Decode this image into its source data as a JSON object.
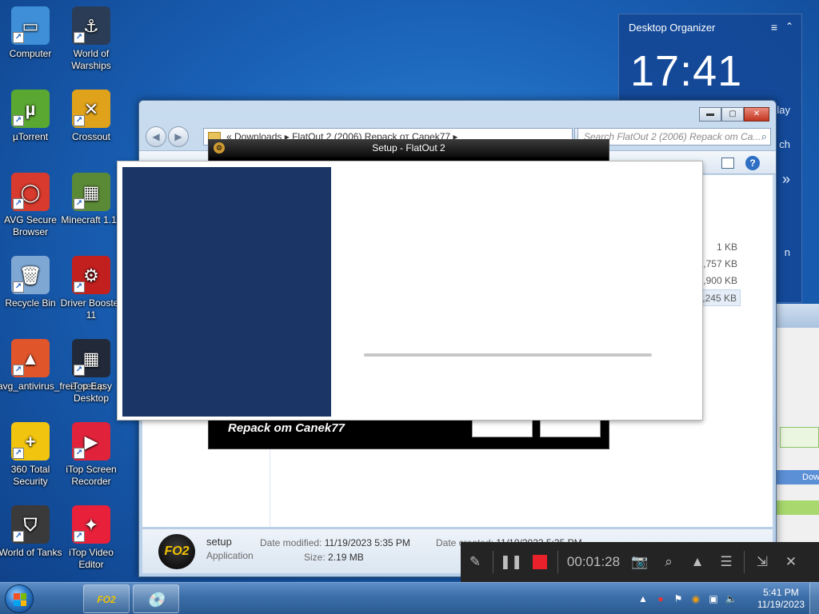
{
  "desktop": {
    "icons": [
      {
        "label": "Computer",
        "glyph": "▭",
        "color": "#3f8fd8"
      },
      {
        "label": "World of Warships",
        "glyph": "⚓",
        "color": "#2b3d56"
      },
      {
        "label": "µTorrent",
        "glyph": "µ",
        "color": "#5aa832"
      },
      {
        "label": "Crossout",
        "glyph": "✕",
        "color": "#e0a21a"
      },
      {
        "label": "AVG Secure Browser",
        "glyph": "◯",
        "color": "#d83a2d"
      },
      {
        "label": "Minecraft 1.11",
        "glyph": "▦",
        "color": "#5b8a37"
      },
      {
        "label": "Recycle Bin",
        "glyph": "🗑",
        "color": "#7fa7d3"
      },
      {
        "label": "Driver Booster 11",
        "glyph": "⚙",
        "color": "#c21f1f"
      },
      {
        "label": "avg_antivirus_free_setup",
        "glyph": "▲",
        "color": "#e0552a"
      },
      {
        "label": "iTop Easy Desktop",
        "glyph": "▦",
        "color": "#222a3a"
      },
      {
        "label": "360 Total Security",
        "glyph": "+",
        "color": "#f1c40f"
      },
      {
        "label": "iTop Screen Recorder",
        "glyph": "▶",
        "color": "#e0233a"
      },
      {
        "label": "World of Tanks",
        "glyph": "⛉",
        "color": "#3a3a3a"
      },
      {
        "label": "iTop Video Editor",
        "glyph": "✦",
        "color": "#e8203a"
      }
    ]
  },
  "gadget": {
    "title": "Desktop Organizer",
    "menu_icon": "hamburger-icon",
    "collapse_icon": "chevron-up-icon",
    "clock": "17:41",
    "fragments": [
      "lay",
      "ch",
      "»",
      "n"
    ]
  },
  "explorer": {
    "address": "«  Downloads  ▸  FlatOut 2 (2006) Repack от Canek77  ▸",
    "search_placeholder": "Search FlatOut 2 (2006) Repack om Ca...",
    "file_sizes": [
      "1 KB",
      "5,757 KB",
      "9,900 KB",
      "2,245 KB"
    ],
    "selected_size_index": 3,
    "details": {
      "name": "setup",
      "type": "Application",
      "modified_label": "Date modified:",
      "modified_value": "11/19/2023 5:35 PM",
      "size_label": "Size:",
      "size_value": "2.19 MB",
      "created_label": "Date created:",
      "created_value": "11/19/2023 5:35 PM",
      "icon_text": "FO2"
    }
  },
  "back_window": {
    "partial_label": "Dow"
  },
  "setup": {
    "title": "Setup - FlatOut 2",
    "repack_text": "Repack om Canek77"
  },
  "splash": {
    "progress_percent": 0
  },
  "recorder": {
    "time": "00:01:28"
  },
  "taskbar": {
    "apps": [
      "FO2",
      "setup"
    ],
    "time": "5:41 PM",
    "date": "11/19/2023"
  }
}
